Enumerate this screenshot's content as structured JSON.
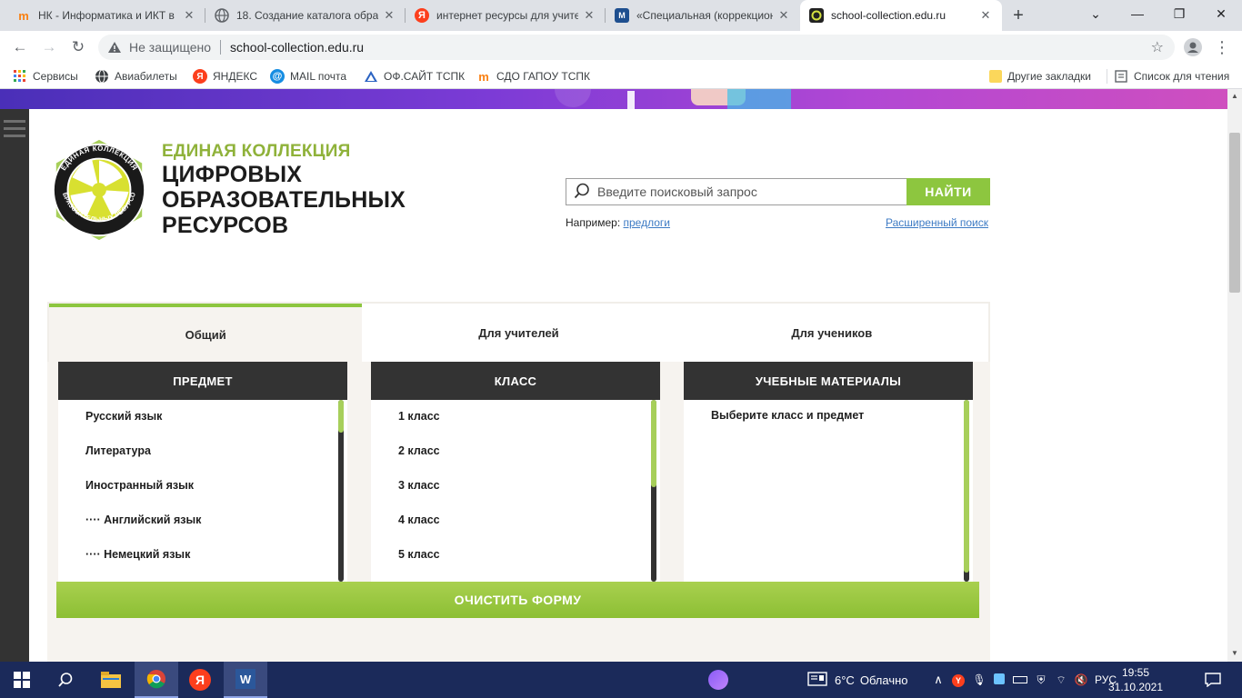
{
  "tabs": [
    {
      "title": "НК - Информатика и ИКТ в",
      "favicon": "moodle-hat-icon"
    },
    {
      "title": "18. Создание каталога обра",
      "favicon": "globe-icon"
    },
    {
      "title": "интернет ресурсы для учите",
      "favicon": "yandex-icon"
    },
    {
      "title": "«Специальная (коррекцион",
      "favicon": "site-logo-icon"
    },
    {
      "title": "school-collection.edu.ru",
      "favicon": "collection-logo-icon",
      "active": true
    }
  ],
  "address": {
    "security_text": "Не защищено",
    "url": "school-collection.edu.ru"
  },
  "bookmarks": [
    {
      "label": "Сервисы",
      "icon": "apps-grid-icon"
    },
    {
      "label": "Авиабилеты",
      "icon": "globe-icon"
    },
    {
      "label": "ЯНДЕКС",
      "icon": "yandex-icon"
    },
    {
      "label": "MAIL почта",
      "icon": "mail-at-icon"
    },
    {
      "label": "ОФ.САЙТ ТСПК",
      "icon": "triangle-logo-icon"
    },
    {
      "label": "СДО ГАПОУ ТСПК",
      "icon": "moodle-hat-icon"
    }
  ],
  "bookmarks_right": {
    "other": "Другие закладки",
    "reading_list": "Список для чтения"
  },
  "site": {
    "brand_line1": "ЕДИНАЯ КОЛЛЕКЦИЯ",
    "brand_line2": "ЦИФРОВЫХ",
    "brand_line3": "ОБРАЗОВАТЕЛЬНЫХ",
    "brand_line4": "РЕСУРСОВ",
    "logo_ring_top": "ЕДИНАЯ КОЛЛЕКЦИЯ",
    "logo_ring_right": "ЦИФРОВЫХ",
    "logo_ring_left": "ОБРАЗОВАТЕЛЬНЫХ РЕСУРСОВ",
    "accent_color": "#8dc63f",
    "dark_color": "#333333"
  },
  "search": {
    "placeholder": "Введите поисковый запрос",
    "value": "",
    "button": "НАЙТИ",
    "example_prefix": "Например:",
    "example_link": "предлоги",
    "advanced": "Расширенный поиск"
  },
  "catalog": {
    "tabs": [
      {
        "label": "Общий",
        "active": true
      },
      {
        "label": "Для учителей"
      },
      {
        "label": "Для учеников"
      }
    ],
    "subject": {
      "header": "ПРЕДМЕТ",
      "items": [
        "Русский язык",
        "Литература",
        "Иностранный язык",
        "···· Английский язык",
        "···· Немецкий язык"
      ]
    },
    "grade": {
      "header": "КЛАСС",
      "items": [
        "1 класс",
        "2 класс",
        "3 класс",
        "4 класс",
        "5 класс"
      ]
    },
    "materials": {
      "header": "УЧЕБНЫЕ МАТЕРИАЛЫ",
      "placeholder": "Выберите класс и предмет"
    },
    "clear_button": "ОЧИСТИТЬ ФОРМУ"
  },
  "taskbar": {
    "weather_temp": "6°C",
    "weather_text": "Облачно",
    "lang": "РУС",
    "time": "19:55",
    "date": "31.10.2021"
  }
}
